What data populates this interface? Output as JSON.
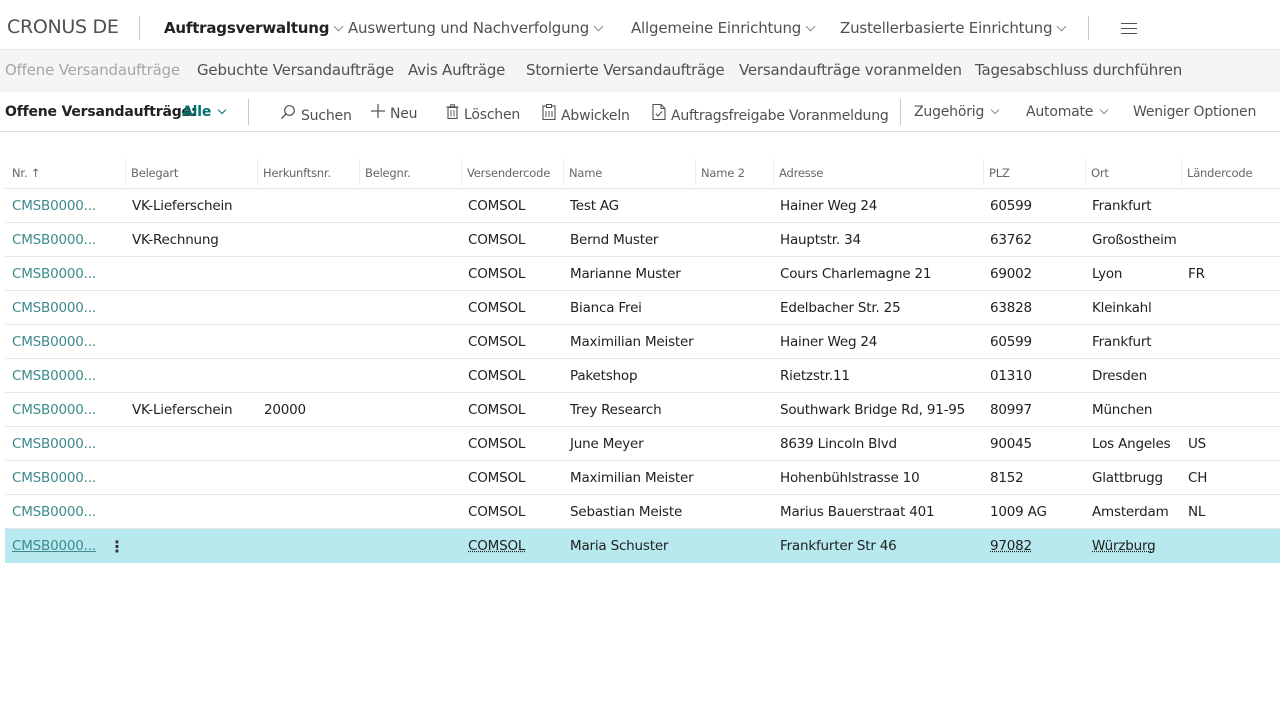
{
  "app": {
    "company": "CRONUS DE"
  },
  "topnav": {
    "items": [
      "Auftragsverwaltung",
      "Auswertung und Nachverfolgung",
      "Allgemeine Einrichtung",
      "Zustellerbasierte Einrichtung"
    ],
    "menu_icon": "hamburger-icon"
  },
  "subnav": {
    "items": [
      "Offene Versandaufträge",
      "Gebuchte Versandaufträge",
      "Avis Aufträge",
      "Stornierte Versandaufträge",
      "Versandaufträge voranmelden",
      "Tagesabschluss durchführen"
    ]
  },
  "actions": {
    "page_title": "Offene Versandaufträge:",
    "filter": "Alle",
    "search": "Suchen",
    "new": "Neu",
    "delete": "Löschen",
    "process": "Abwickeln",
    "release": "Auftragsfreigabe Voranmeldung",
    "related": "Zugehörig",
    "automate": "Automate",
    "fewer": "Weniger Optionen"
  },
  "table": {
    "columns": [
      "Nr. ↑",
      "Belegart",
      "Herkunftsnr.",
      "Belegnr.",
      "Versendercode",
      "Name",
      "Name 2",
      "Adresse",
      "PLZ",
      "Ort",
      "Ländercode"
    ],
    "rows": [
      {
        "nr": "CMSB0000...",
        "belegart": "VK-Lieferschein",
        "herkunft": "",
        "belegnr": "",
        "code": "COMSOL",
        "name": "Test AG",
        "name2": "",
        "adresse": "Hainer Weg 24",
        "plz": "60599",
        "ort": "Frankfurt",
        "land": ""
      },
      {
        "nr": "CMSB0000...",
        "belegart": "VK-Rechnung",
        "herkunft": "",
        "belegnr": "",
        "code": "COMSOL",
        "name": "Bernd Muster",
        "name2": "",
        "adresse": "Hauptstr. 34",
        "plz": "63762",
        "ort": "Großostheim",
        "land": ""
      },
      {
        "nr": "CMSB0000...",
        "belegart": "",
        "herkunft": "",
        "belegnr": "",
        "code": "COMSOL",
        "name": "Marianne Muster",
        "name2": "",
        "adresse": "Cours Charlemagne 21",
        "plz": "69002",
        "ort": "Lyon",
        "land": "FR"
      },
      {
        "nr": "CMSB0000...",
        "belegart": "",
        "herkunft": "",
        "belegnr": "",
        "code": "COMSOL",
        "name": "Bianca Frei",
        "name2": "",
        "adresse": "Edelbacher Str. 25",
        "plz": "63828",
        "ort": "Kleinkahl",
        "land": ""
      },
      {
        "nr": "CMSB0000...",
        "belegart": "",
        "herkunft": "",
        "belegnr": "",
        "code": "COMSOL",
        "name": "Maximilian Meister",
        "name2": "",
        "adresse": "Hainer Weg 24",
        "plz": "60599",
        "ort": "Frankfurt",
        "land": ""
      },
      {
        "nr": "CMSB0000...",
        "belegart": "",
        "herkunft": "",
        "belegnr": "",
        "code": "COMSOL",
        "name": "Paketshop",
        "name2": "",
        "adresse": "Rietzstr.11",
        "plz": "01310",
        "ort": "Dresden",
        "land": ""
      },
      {
        "nr": "CMSB0000...",
        "belegart": "VK-Lieferschein",
        "herkunft": "20000",
        "belegnr": "",
        "code": "COMSOL",
        "name": "Trey Research",
        "name2": "",
        "adresse": "Southwark Bridge Rd, 91-95",
        "plz": "80997",
        "ort": "München",
        "land": ""
      },
      {
        "nr": "CMSB0000...",
        "belegart": "",
        "herkunft": "",
        "belegnr": "",
        "code": "COMSOL",
        "name": "June Meyer",
        "name2": "",
        "adresse": "8639 Lincoln Blvd",
        "plz": "90045",
        "ort": "Los Angeles",
        "land": "US"
      },
      {
        "nr": "CMSB0000...",
        "belegart": "",
        "herkunft": "",
        "belegnr": "",
        "code": "COMSOL",
        "name": "Maximilian Meister",
        "name2": "",
        "adresse": "Hohenbühlstrasse 10",
        "plz": "8152",
        "ort": "Glattbrugg",
        "land": "CH"
      },
      {
        "nr": "CMSB0000...",
        "belegart": "",
        "herkunft": "",
        "belegnr": "",
        "code": "COMSOL",
        "name": "Sebastian Meiste",
        "name2": "",
        "adresse": "Marius Bauerstraat 401",
        "plz": "1009 AG",
        "ort": "Amsterdam",
        "land": "NL"
      },
      {
        "nr": "CMSB0000...",
        "belegart": "",
        "herkunft": "",
        "belegnr": "",
        "code": "COMSOL",
        "name": "Maria Schuster",
        "name2": "",
        "adresse": "Frankfurter Str 46",
        "plz": "97082",
        "ort": "Würzburg",
        "land": ""
      }
    ],
    "selected_row": 10
  },
  "colors": {
    "accent": "#00706c",
    "link": "#3d8b8a",
    "selected_row": "#b8e9ef"
  }
}
